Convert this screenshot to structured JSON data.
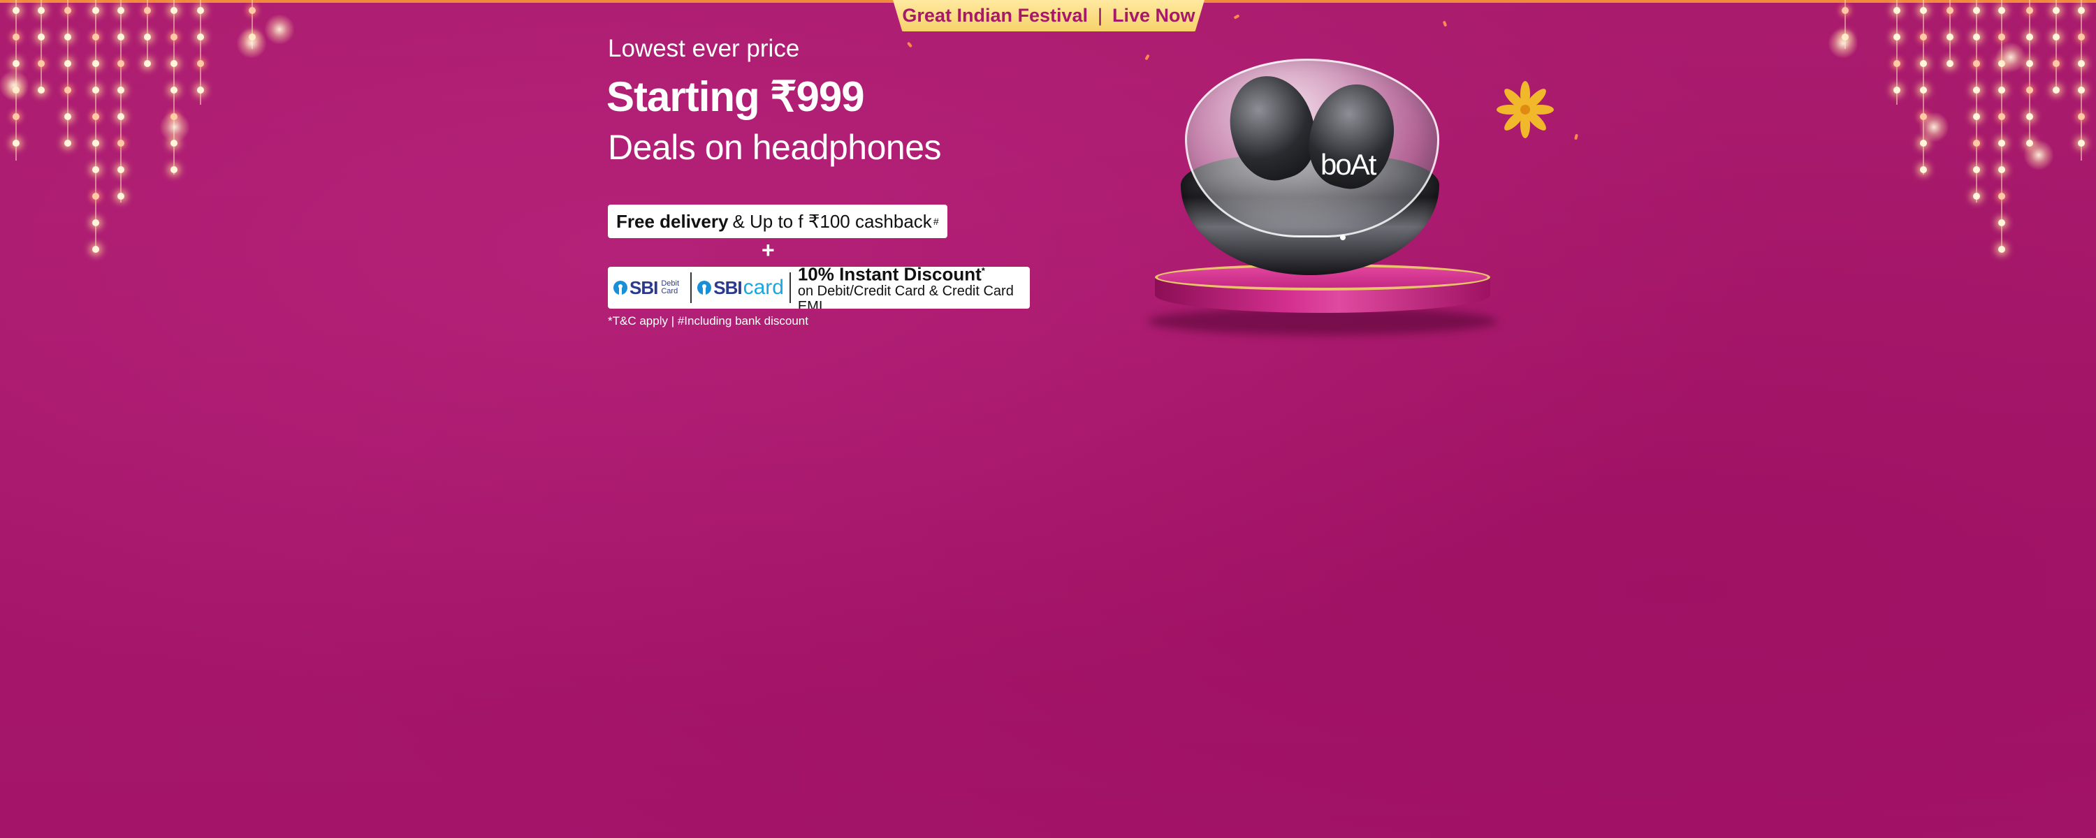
{
  "banner": {
    "festival_name": "Great Indian Festival",
    "separator": "|",
    "status": "Live Now"
  },
  "offer": {
    "eyebrow": "Lowest ever price",
    "price_line": "Starting ₹999",
    "category": "Deals on headphones",
    "delivery_bold": "Free delivery",
    "delivery_rest": "& Up to f ₹100 cashback",
    "delivery_mark": "#",
    "plus": "+",
    "bank_name": "SBI",
    "bank_card_type": "Debit Card",
    "bank_card_word": "card",
    "discount_main": "10% Instant Discount",
    "discount_mark": "*",
    "discount_sub": "on Debit/Credit Card & Credit Card EMI",
    "tnc": "*T&C apply | #Including bank discount"
  },
  "product": {
    "brand": "boAt"
  },
  "colors": {
    "background": "#a8186a",
    "ribbon": "#f6d26a",
    "accent_text": "#a8186a",
    "sbi_blue": "#2b3a8c",
    "sbi_card_blue": "#1aa7e0"
  }
}
